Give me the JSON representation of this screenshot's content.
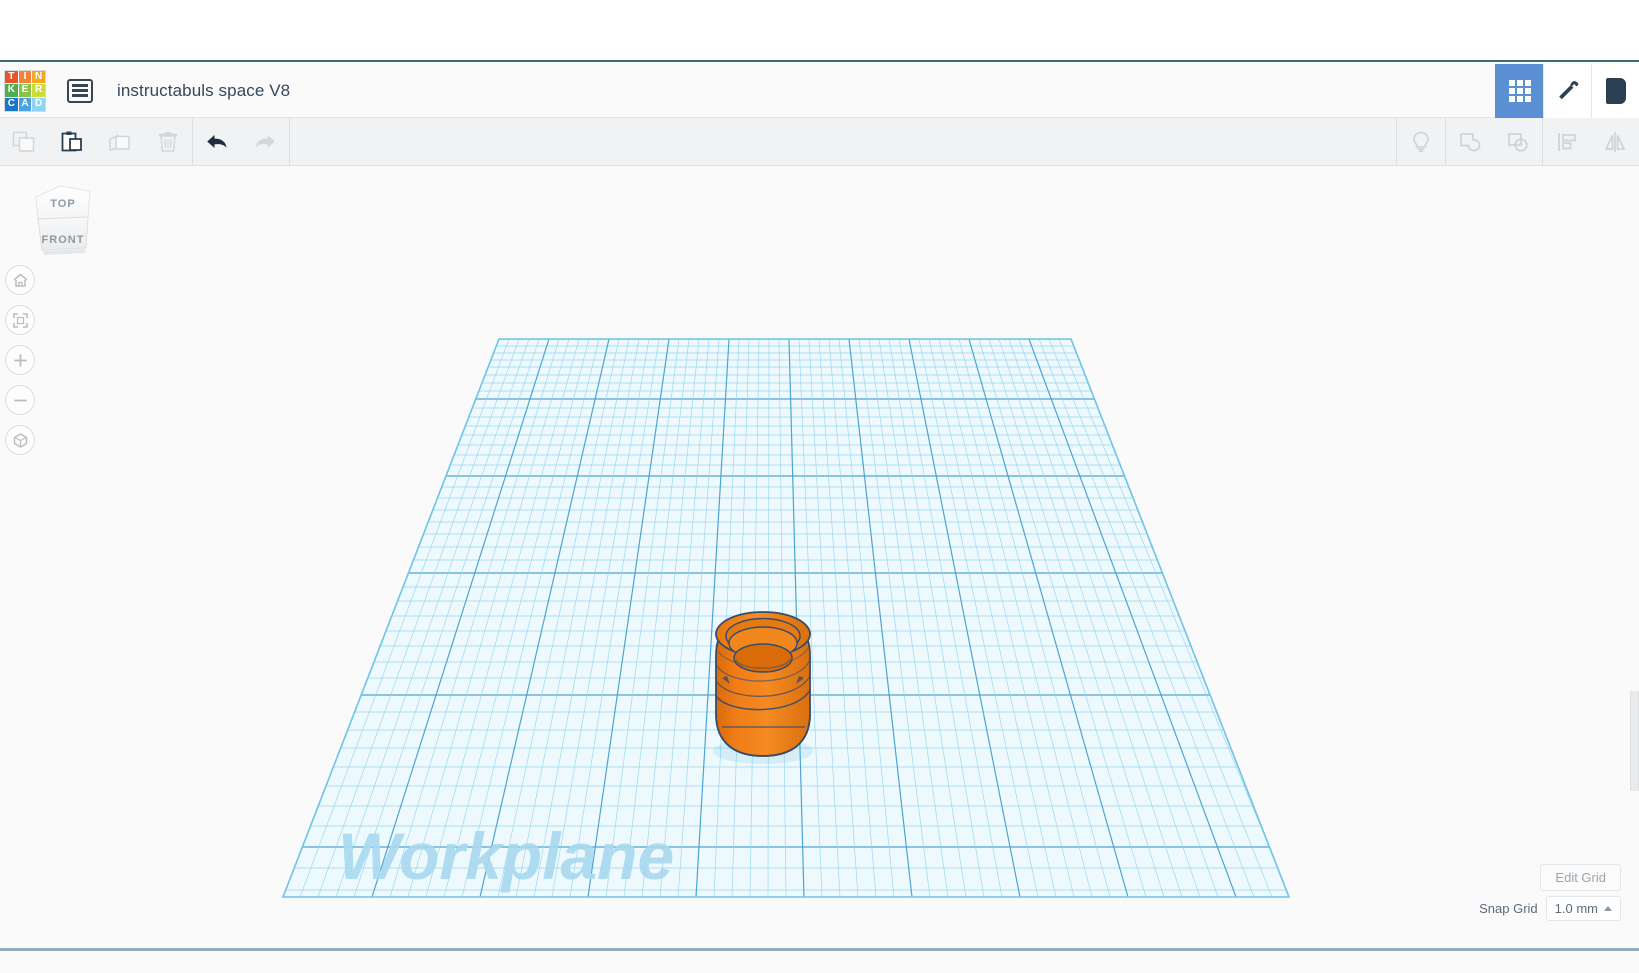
{
  "app": {
    "name": "Tinkercad",
    "logo_letters": [
      "T",
      "I",
      "N",
      "K",
      "E",
      "R",
      "C",
      "A",
      "D"
    ],
    "logo_colors": [
      "#e8552d",
      "#f0833a",
      "#f5a623",
      "#4caf50",
      "#8bc34a",
      "#cddc39",
      "#1b77c6",
      "#4aa3df",
      "#8fd3f4"
    ]
  },
  "header": {
    "project_title": "instructabuls space V8",
    "doc_icon": "list-document-icon",
    "buttons": [
      {
        "name": "grid-view-button",
        "icon": "grid-9-icon",
        "active": true
      },
      {
        "name": "build-tool-button",
        "icon": "hammer-icon",
        "active": false
      },
      {
        "name": "blocks-button",
        "icon": "block-icon",
        "active": false
      }
    ]
  },
  "toolbar": {
    "left_items": [
      {
        "label": "Copy",
        "icon": "copy-icon",
        "disabled": true
      },
      {
        "label": "Paste",
        "icon": "paste-icon",
        "disabled": false
      },
      {
        "label": "Duplicate",
        "icon": "duplicate-icon",
        "disabled": true
      },
      {
        "label": "Delete",
        "icon": "trash-icon",
        "disabled": true
      },
      {
        "label": "Undo",
        "icon": "undo-icon",
        "disabled": false
      },
      {
        "label": "Redo",
        "icon": "redo-icon",
        "disabled": true
      }
    ],
    "right_items": [
      {
        "label": "Hint",
        "icon": "lightbulb-icon",
        "disabled": true
      },
      {
        "label": "Group",
        "icon": "group-icon",
        "disabled": true
      },
      {
        "label": "Ungroup",
        "icon": "ungroup-icon",
        "disabled": true
      },
      {
        "label": "Align",
        "icon": "align-icon",
        "disabled": true
      },
      {
        "label": "Mirror",
        "icon": "mirror-icon",
        "disabled": true
      }
    ]
  },
  "viewcube": {
    "top_face": "TOP",
    "front_face": "FRONT"
  },
  "nav_controls": [
    {
      "name": "home-view-button",
      "icon": "home-icon"
    },
    {
      "name": "fit-view-button",
      "icon": "fit-all-icon"
    },
    {
      "name": "zoom-in-button",
      "icon": "plus-icon"
    },
    {
      "name": "zoom-out-button",
      "icon": "minus-icon"
    },
    {
      "name": "ortho-view-button",
      "icon": "cube-icon"
    }
  ],
  "canvas": {
    "workplane_label": "Workplane",
    "grid_color_minor": "#8ed2ef",
    "grid_color_major": "#3c9ac9",
    "plane_fill": "#ecf8fd",
    "object": {
      "name": "threaded-cylinder-object",
      "color": "#f07d18",
      "outline": "#3a4a6b"
    }
  },
  "footer": {
    "edit_grid_label": "Edit Grid",
    "snap_grid_label": "Snap Grid",
    "snap_grid_value": "1.0 mm"
  }
}
